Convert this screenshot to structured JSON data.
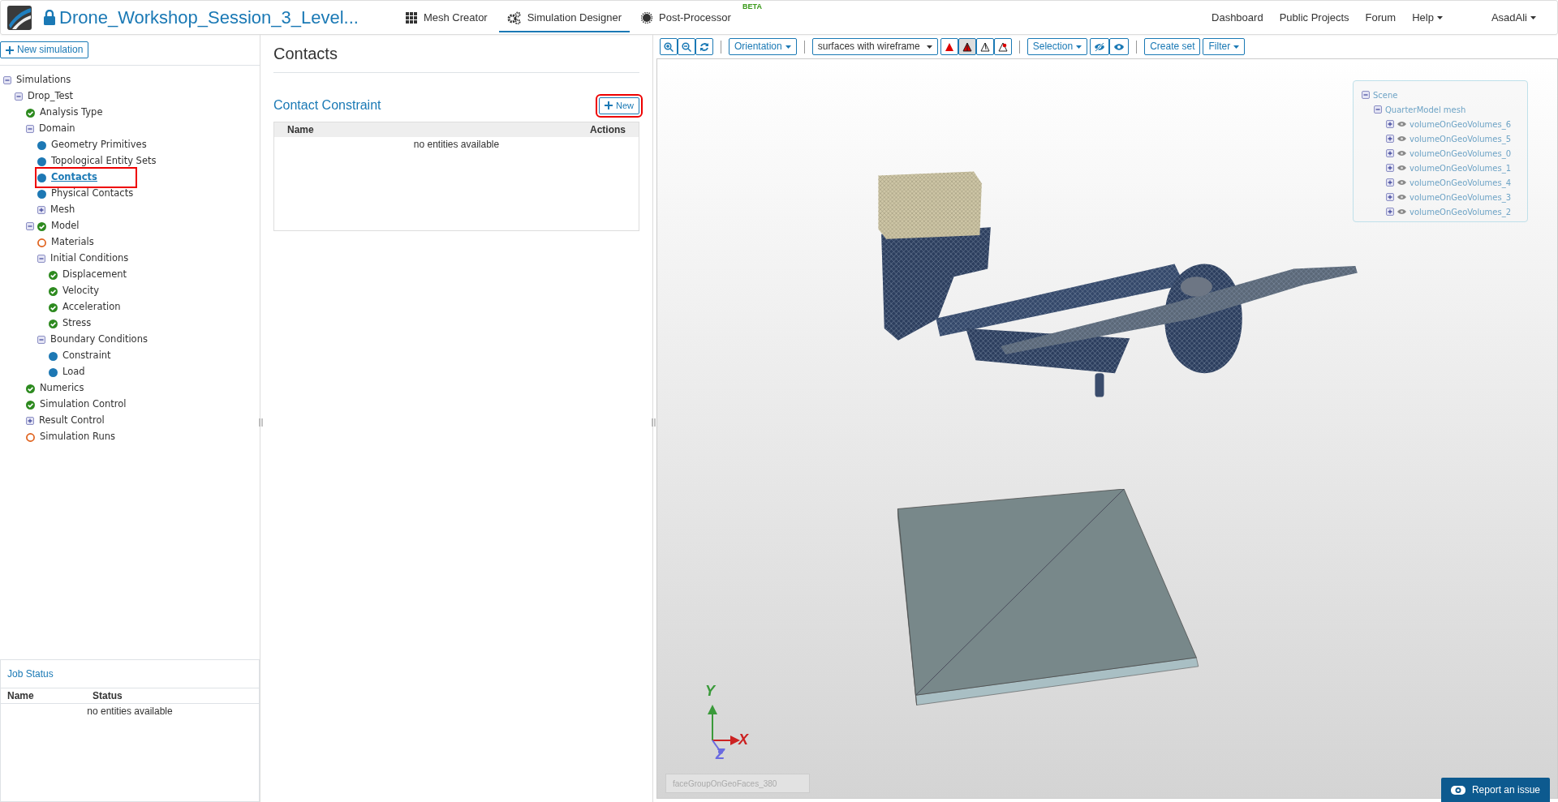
{
  "header": {
    "project_title": "Drone_Workshop_Session_3_Level...",
    "tabs": [
      {
        "label": "Mesh Creator",
        "kind": "grid",
        "selected": false
      },
      {
        "label": "Simulation Designer",
        "kind": "gears",
        "selected": true
      },
      {
        "label": "Post-Processor",
        "kind": "sun",
        "selected": false,
        "badge": "BETA"
      }
    ],
    "nav_links": [
      {
        "label": "Dashboard",
        "dropdown": false
      },
      {
        "label": "Public Projects",
        "dropdown": false
      },
      {
        "label": "Forum",
        "dropdown": false
      },
      {
        "label": "Help",
        "dropdown": true
      },
      {
        "label": "AsadAli",
        "dropdown": true
      }
    ]
  },
  "sidebar": {
    "new_button": "New simulation",
    "tree": [
      {
        "label": "Simulations",
        "expanded": true,
        "selected": false,
        "children": [
          {
            "label": "Drop_Test",
            "expanded": true,
            "selected": false,
            "children": [
              {
                "label": "Analysis Type",
                "kind": "done",
                "selected": false
              },
              {
                "label": "Domain",
                "expanded": true,
                "selected": false,
                "children": [
                  {
                    "label": "Geometry Primitives",
                    "kind": "info",
                    "selected": false
                  },
                  {
                    "label": "Topological Entity Sets",
                    "kind": "info",
                    "selected": false
                  },
                  {
                    "label": "Contacts",
                    "kind": "info",
                    "selected": true
                  },
                  {
                    "label": "Physical Contacts",
                    "kind": "info",
                    "selected": false
                  },
                  {
                    "label": "Mesh",
                    "expanded": false,
                    "selected": false
                  }
                ]
              },
              {
                "label": "Model",
                "expanded": true,
                "kind": "done",
                "selected": false,
                "children": [
                  {
                    "label": "Materials",
                    "kind": "todo",
                    "selected": false
                  },
                  {
                    "label": "Initial Conditions",
                    "expanded": true,
                    "selected": false,
                    "children": [
                      {
                        "label": "Displacement",
                        "kind": "done",
                        "selected": false
                      },
                      {
                        "label": "Velocity",
                        "kind": "done",
                        "selected": false
                      },
                      {
                        "label": "Acceleration",
                        "kind": "done",
                        "selected": false
                      },
                      {
                        "label": "Stress",
                        "kind": "done",
                        "selected": false
                      }
                    ]
                  },
                  {
                    "label": "Boundary Conditions",
                    "expanded": true,
                    "selected": false,
                    "children": [
                      {
                        "label": "Constraint",
                        "kind": "info",
                        "selected": false
                      },
                      {
                        "label": "Load",
                        "kind": "info",
                        "selected": false
                      }
                    ]
                  }
                ]
              },
              {
                "label": "Numerics",
                "kind": "done",
                "selected": false
              },
              {
                "label": "Simulation Control",
                "kind": "done",
                "selected": false
              },
              {
                "label": "Result Control",
                "expanded": false,
                "selected": false
              },
              {
                "label": "Simulation Runs",
                "kind": "todo",
                "selected": false
              }
            ]
          }
        ]
      }
    ]
  },
  "job_status": {
    "title": "Job Status",
    "columns": [
      "Name",
      "Status"
    ],
    "empty_text": "no entities available"
  },
  "contacts": {
    "title": "Contacts",
    "section_title": "Contact Constraint",
    "new_button": {
      "label": "New",
      "highlighted": true
    },
    "columns": [
      "Name",
      "Actions"
    ],
    "empty_text": "no entities available"
  },
  "viewer": {
    "toolbar": {
      "orientation": "Orientation",
      "render_select": "surfaces with wireframe",
      "render_modes": [
        {
          "kind": "solid",
          "selected": false
        },
        {
          "kind": "solid-edges",
          "selected": true
        },
        {
          "kind": "wireframe",
          "selected": false
        },
        {
          "kind": "points",
          "selected": false
        }
      ],
      "selection": "Selection",
      "create_set": "Create set",
      "filter": "Filter"
    },
    "scene_tree": {
      "label": "Scene",
      "expanded": true,
      "children": [
        {
          "label": "QuarterModel mesh",
          "expanded": true,
          "children": [
            {
              "label": "volumeOnGeoVolumes_6",
              "expanded": false,
              "visible": true
            },
            {
              "label": "volumeOnGeoVolumes_5",
              "expanded": false,
              "visible": true
            },
            {
              "label": "volumeOnGeoVolumes_0",
              "expanded": false,
              "visible": true
            },
            {
              "label": "volumeOnGeoVolumes_1",
              "expanded": false,
              "visible": true
            },
            {
              "label": "volumeOnGeoVolumes_4",
              "expanded": false,
              "visible": true
            },
            {
              "label": "volumeOnGeoVolumes_3",
              "expanded": false,
              "visible": true
            },
            {
              "label": "volumeOnGeoVolumes_2",
              "expanded": false,
              "visible": true
            }
          ]
        }
      ]
    },
    "axes": {
      "x": "X",
      "y": "Y",
      "z": "Z"
    },
    "selection_field": {
      "placeholder": "faceGroupOnGeoFaces_380"
    },
    "report_button": "Report an issue"
  }
}
